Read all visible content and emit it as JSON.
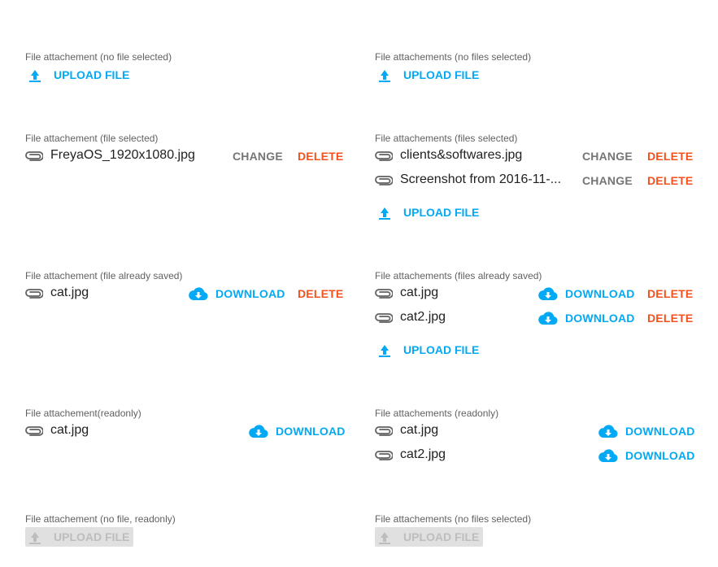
{
  "colors": {
    "accent": "#03a9f4",
    "delete": "#f4511e",
    "change": "#757575",
    "disabled_bg": "#e0e0e0",
    "disabled_text": "#bdbdbd"
  },
  "icons": {
    "upload": "upload-arrow-icon",
    "file": "paperclip-icon",
    "download": "cloud-download-icon"
  },
  "left": {
    "no_file": {
      "label": "File attachement (no file selected)",
      "upload": "UPLOAD FILE"
    },
    "file_selected": {
      "label": "File attachement (file selected)",
      "file": "FreyaOS_1920x1080.jpg",
      "change": "CHANGE",
      "delete": "DELETE"
    },
    "file_saved": {
      "label": "File attachement (file already saved)",
      "file": "cat.jpg",
      "download": "DOWNLOAD",
      "delete": "DELETE"
    },
    "readonly": {
      "label": "File attachement(readonly)",
      "file": "cat.jpg",
      "download": "DOWNLOAD"
    },
    "no_file_readonly": {
      "label": "File attachement (no file, readonly)",
      "upload": "UPLOAD FILE"
    }
  },
  "right": {
    "no_files": {
      "label": "File attachements (no files selected)",
      "upload": "UPLOAD FILE"
    },
    "files_selected": {
      "label": "File attachements (files selected)",
      "files": [
        {
          "name": "clients&softwares.jpg",
          "change": "CHANGE",
          "delete": "DELETE"
        },
        {
          "name": "Screenshot from 2016-11-...",
          "change": "CHANGE",
          "delete": "DELETE"
        }
      ],
      "upload": "UPLOAD FILE"
    },
    "files_saved": {
      "label": "File attachements (files already saved)",
      "files": [
        {
          "name": "cat.jpg",
          "download": "DOWNLOAD",
          "delete": "DELETE"
        },
        {
          "name": "cat2.jpg",
          "download": "DOWNLOAD",
          "delete": "DELETE"
        }
      ],
      "upload": "UPLOAD FILE"
    },
    "readonly": {
      "label": "File attachements (readonly)",
      "files": [
        {
          "name": "cat.jpg",
          "download": "DOWNLOAD"
        },
        {
          "name": "cat2.jpg",
          "download": "DOWNLOAD"
        }
      ]
    },
    "no_files_readonly": {
      "label": "File attachements (no files selected)",
      "upload": "UPLOAD FILE"
    }
  }
}
